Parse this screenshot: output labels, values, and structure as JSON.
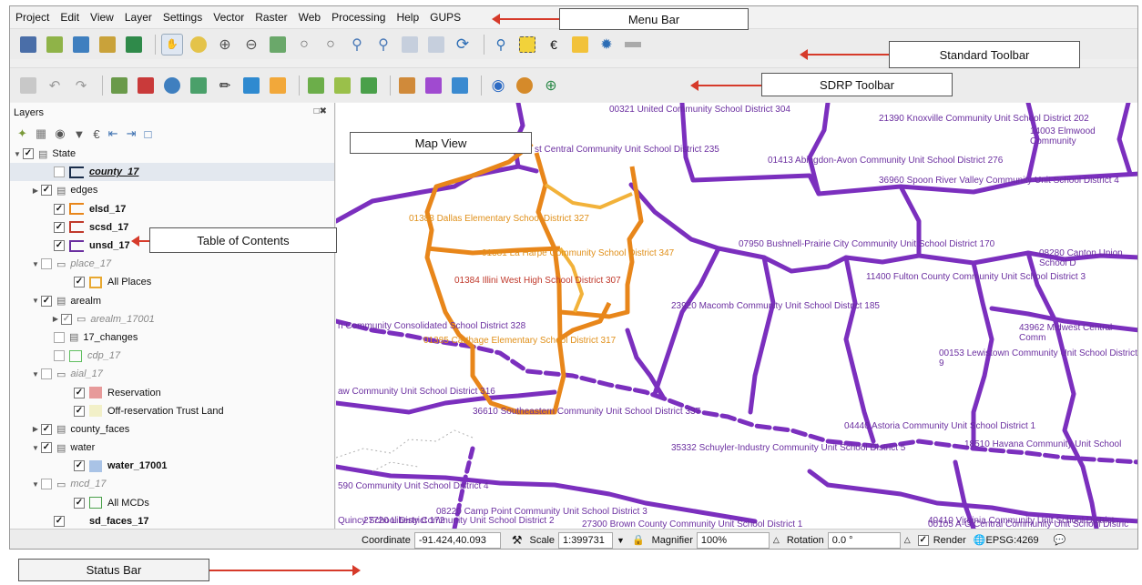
{
  "menu": [
    "Project",
    "Edit",
    "View",
    "Layer",
    "Settings",
    "Vector",
    "Raster",
    "Web",
    "Processing",
    "Help",
    "GUPS"
  ],
  "layers_panel": {
    "title": "Layers",
    "items": [
      {
        "label": "State",
        "style": "normal",
        "checked": true
      },
      {
        "label": "county_17",
        "style": "bi",
        "checked": false
      },
      {
        "label": "edges",
        "style": "normal",
        "checked": true
      },
      {
        "label": "elsd_17",
        "style": "b",
        "checked": true
      },
      {
        "label": "scsd_17",
        "style": "b",
        "checked": true
      },
      {
        "label": "unsd_17",
        "style": "b",
        "checked": true
      },
      {
        "label": "place_17",
        "style": "i",
        "checked": false
      },
      {
        "label": "All Places",
        "style": "normal",
        "checked": true
      },
      {
        "label": "arealm",
        "style": "normal",
        "checked": true
      },
      {
        "label": "arealm_17001",
        "style": "i",
        "checked": true
      },
      {
        "label": "17_changes",
        "style": "normal",
        "checked": false
      },
      {
        "label": "cdp_17",
        "style": "i",
        "checked": false
      },
      {
        "label": "aial_17",
        "style": "i",
        "checked": false
      },
      {
        "label": "Reservation",
        "style": "normal",
        "checked": true
      },
      {
        "label": "Off-reservation Trust Land",
        "style": "normal",
        "checked": true
      },
      {
        "label": "county_faces",
        "style": "normal",
        "checked": true
      },
      {
        "label": "water",
        "style": "normal",
        "checked": true
      },
      {
        "label": "water_17001",
        "style": "b",
        "checked": true
      },
      {
        "label": "mcd_17",
        "style": "i",
        "checked": false
      },
      {
        "label": "All MCDs",
        "style": "normal",
        "checked": true
      },
      {
        "label": "sd_faces_17",
        "style": "b",
        "checked": true
      }
    ]
  },
  "map_labels": [
    {
      "text": "00321 United Community School District 304",
      "color": "#6b2fa0"
    },
    {
      "text": "21390 Knoxville Community Unit School District 202",
      "color": "#6b2fa0"
    },
    {
      "text": "14003 Elmwood Community",
      "color": "#6b2fa0"
    },
    {
      "text": "st Central Community Unit School District 235",
      "color": "#6b2fa0"
    },
    {
      "text": "01413 Abingdon-Avon Community Unit School District 276",
      "color": "#6b2fa0"
    },
    {
      "text": "36960 Spoon River Valley Community Unit School District 4",
      "color": "#6b2fa0"
    },
    {
      "text": "01388 Dallas Elementary School District 327",
      "color": "#e0901a"
    },
    {
      "text": "01381 La Harpe Community School District 347",
      "color": "#e0901a"
    },
    {
      "text": "07950 Bushnell-Prairie City Community Unit School District 170",
      "color": "#6b2fa0"
    },
    {
      "text": "08280 Canton Union School D",
      "color": "#6b2fa0"
    },
    {
      "text": "01384 Illini West High School District 307",
      "color": "#c0392b"
    },
    {
      "text": "11400 Fulton County Community Unit School District 3",
      "color": "#6b2fa0"
    },
    {
      "text": "23920 Macomb Community Unit School District 185",
      "color": "#6b2fa0"
    },
    {
      "text": "n Community Consolidated School District 328",
      "color": "#6b2fa0"
    },
    {
      "text": "01385 Carthage Elementary School District 317",
      "color": "#e0901a"
    },
    {
      "text": "43962 Midwest Central Comm",
      "color": "#6b2fa0"
    },
    {
      "text": "00153 Lewistown Community Unit School District 9",
      "color": "#6b2fa0"
    },
    {
      "text": "aw Community Unit School District 316",
      "color": "#6b2fa0"
    },
    {
      "text": "36610 Southeastern Community Unit School District 337",
      "color": "#6b2fa0"
    },
    {
      "text": "04440 Astoria Community Unit School District 1",
      "color": "#6b2fa0"
    },
    {
      "text": "35332 Schuyler-Industry Community Unit School District 5",
      "color": "#6b2fa0"
    },
    {
      "text": "18510 Havana Community Unit School",
      "color": "#6b2fa0"
    },
    {
      "text": "590 Community Unit School District 4",
      "color": "#6b2fa0"
    },
    {
      "text": "08220 Camp Point Community Unit School District 3",
      "color": "#6b2fa0"
    },
    {
      "text": "27300 Brown County Community Unit School District 1",
      "color": "#6b2fa0"
    },
    {
      "text": "00105 A-C Central Community Unit School Distric",
      "color": "#6b2fa0"
    },
    {
      "text": "Quincy School District 172",
      "color": "#6b2fa0"
    },
    {
      "text": "27720 Liberty Community Unit School District 2",
      "color": "#6b2fa0"
    },
    {
      "text": "40410 Virginia Community Unit School District",
      "color": "#6b2fa0"
    }
  ],
  "status": {
    "coordinate_label": "Coordinate",
    "coordinate_value": "-91.424,40.093",
    "scale_label": "Scale",
    "scale_value": "1:399731",
    "magnifier_label": "Magnifier",
    "magnifier_value": "100%",
    "rotation_label": "Rotation",
    "rotation_value": "0.0 °",
    "render_label": "Render",
    "crs": "EPSG:4269"
  },
  "callouts": {
    "menu_bar": "Menu Bar",
    "standard_toolbar": "Standard Toolbar",
    "sdrp_toolbar": "SDRP Toolbar",
    "map_view": "Map View",
    "table_of_contents": "Table of Contents",
    "status_bar": "Status Bar"
  },
  "colors": {
    "purple": "#7b2fbe",
    "orange": "#e8861a",
    "light_orange": "#f2b23a",
    "red_arrow": "#d63a2a"
  }
}
